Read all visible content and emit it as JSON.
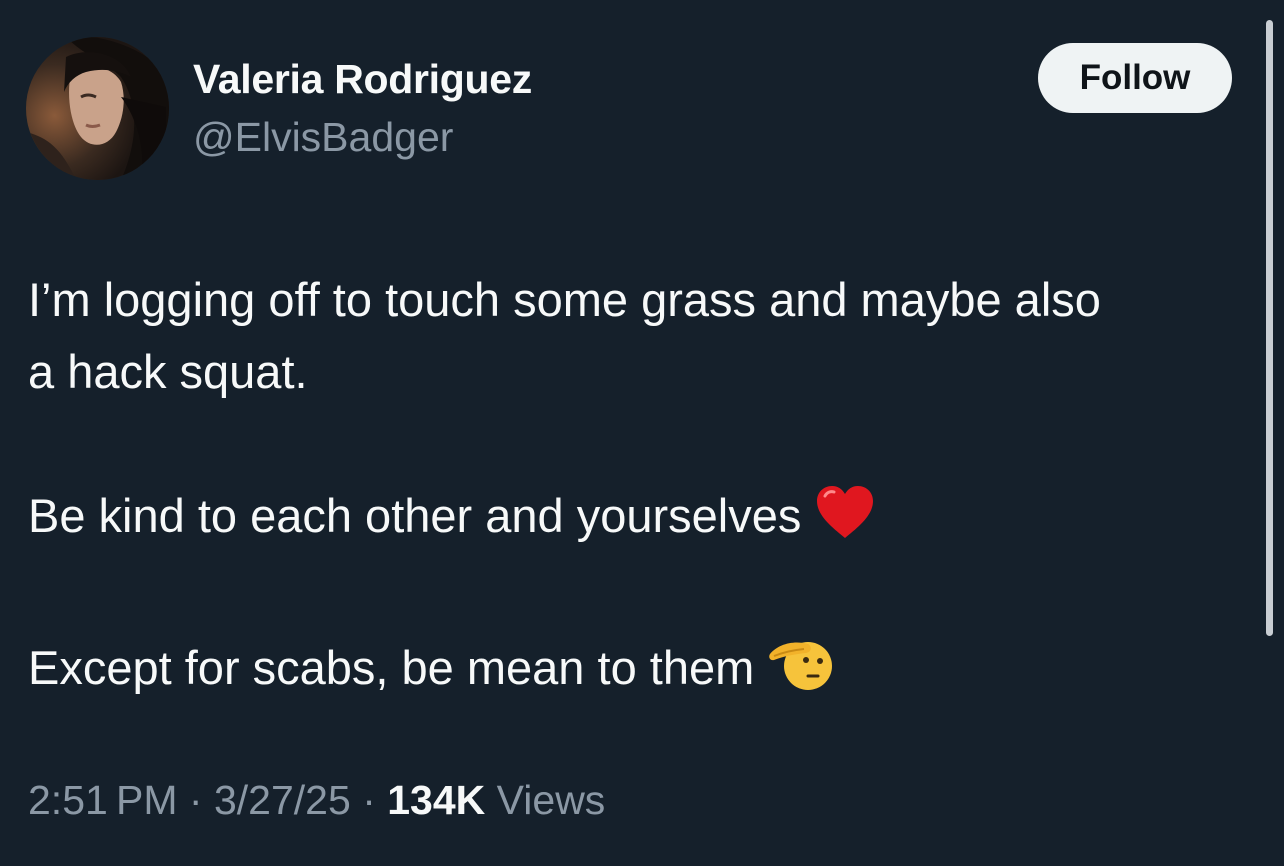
{
  "author": {
    "display_name": "Valeria Rodriguez",
    "handle": "@ElvisBadger",
    "avatar_icon": "profile-photo"
  },
  "follow_button": {
    "label": "Follow"
  },
  "tweet": {
    "paragraphs": [
      "I’m logging off to touch some grass and maybe also",
      "a hack squat.",
      "Be kind to each other and yourselves",
      "Except for scabs, be mean to them"
    ],
    "emojis": [
      "red-heart-emoji",
      "saluting-face-emoji"
    ]
  },
  "meta": {
    "time": "2:51 PM",
    "separator": "·",
    "date": "3/27/25",
    "views_count": "134K",
    "views_label": "Views"
  },
  "colors": {
    "background": "#15202b",
    "primary_text": "#f7f9f9",
    "secondary_text": "#8b98a5",
    "follow_bg": "#eff3f4",
    "heart": "#e0171f",
    "salute": "#f6c33b"
  }
}
